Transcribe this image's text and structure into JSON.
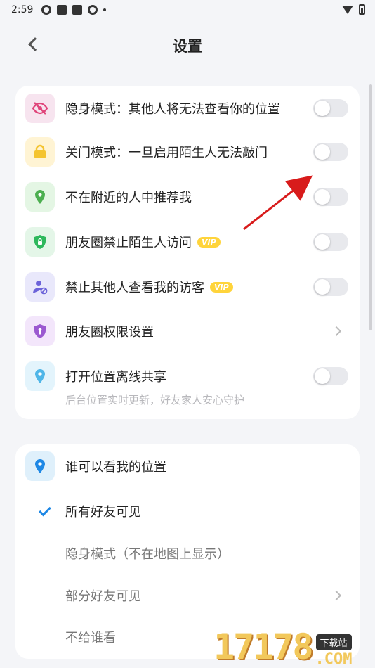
{
  "status": {
    "time": "2:59"
  },
  "header": {
    "title": "设置"
  },
  "privacy": {
    "items": [
      {
        "label": "隐身模式：其他人将无法查看你的位置",
        "icon": "eye-slash-icon",
        "color": "#f7e4ef",
        "accent": "#e0457b",
        "control": "toggle",
        "vip": ""
      },
      {
        "label": "关门模式：一旦启用陌生人无法敲门",
        "icon": "lock-icon",
        "color": "#fff4d4",
        "accent": "#f4c430",
        "control": "toggle",
        "vip": ""
      },
      {
        "label": "不在附近的人中推荐我",
        "icon": "location-pin-icon",
        "color": "#e4f6e4",
        "accent": "#4caf50",
        "control": "toggle",
        "vip": ""
      },
      {
        "label": "朋友圈禁止陌生人访问",
        "icon": "shield-lock-icon",
        "color": "#e4f6e8",
        "accent": "#2eb85c",
        "control": "toggle",
        "vip": "VIP"
      },
      {
        "label": "禁止其他人查看我的访客",
        "icon": "user-block-icon",
        "color": "#e9e8fb",
        "accent": "#6c63d9",
        "control": "toggle",
        "vip": "VIP"
      },
      {
        "label": "朋友圈权限设置",
        "icon": "shield-key-icon",
        "color": "#f3e6fb",
        "accent": "#9b59d0",
        "control": "chevron",
        "vip": ""
      },
      {
        "label": "打开位置离线共享",
        "icon": "location-pin-icon",
        "color": "#e3f4fc",
        "accent": "#4fb6e8",
        "control": "toggle",
        "vip": ""
      }
    ],
    "offline_share_desc": "后台位置实时更新，好友家人安心守护"
  },
  "visibility": {
    "title": "谁可以看我的位置",
    "icon": "location-pin-icon",
    "options": [
      {
        "label": "所有好友可见",
        "selected": true
      },
      {
        "label": "隐身模式（不在地图上显示）",
        "selected": false
      },
      {
        "label": "部分好友可见",
        "selected": false
      },
      {
        "label": "不给谁看",
        "selected": false
      }
    ]
  },
  "watermark": {
    "digits": "17178",
    "tag": "下载站",
    "domain": ".COM"
  }
}
